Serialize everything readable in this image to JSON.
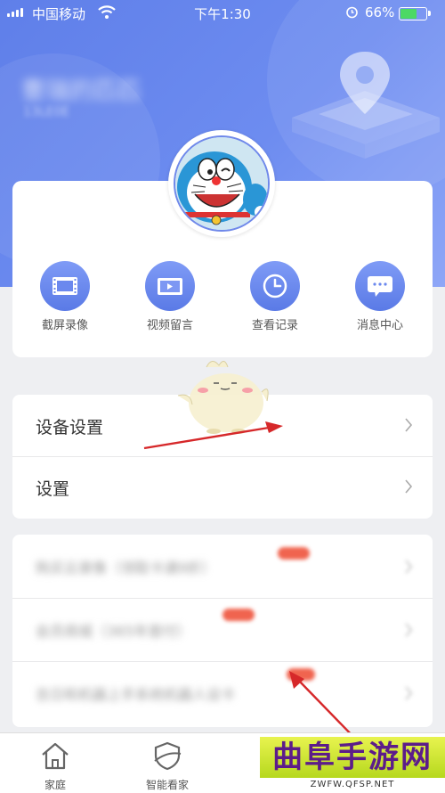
{
  "status_bar": {
    "carrier": "中国移动",
    "time": "下午1:30",
    "battery_percent": "66%",
    "battery_level": 0.66,
    "battery_color": "#4cd964"
  },
  "profile": {
    "name": "曹瑞的匹匹",
    "subtitle": "13LE0E",
    "accent_color": "#6a88ee"
  },
  "quick_actions": [
    {
      "label": "截屏录像",
      "icon": "film-icon"
    },
    {
      "label": "视频留言",
      "icon": "video-message-icon"
    },
    {
      "label": "查看记录",
      "icon": "clock-icon"
    },
    {
      "label": "消息中心",
      "icon": "message-icon"
    }
  ],
  "menu": {
    "device_settings": "设备设置",
    "settings": "设置"
  },
  "blurred_items": [
    {
      "label": "购买云录像（领取卡通9折）"
    },
    {
      "label": "会员商城（365年首付）"
    },
    {
      "label": "吉日和机器上手系统机器人设卡"
    }
  ],
  "tabbar": [
    {
      "label": "家庭",
      "icon": "house-icon"
    },
    {
      "label": "智能看家",
      "icon": "shield-icon"
    }
  ],
  "watermark": {
    "title": "曲阜手游网",
    "url": "ZWFW.QFSP.NET"
  },
  "annotation_color": "#d6282a"
}
